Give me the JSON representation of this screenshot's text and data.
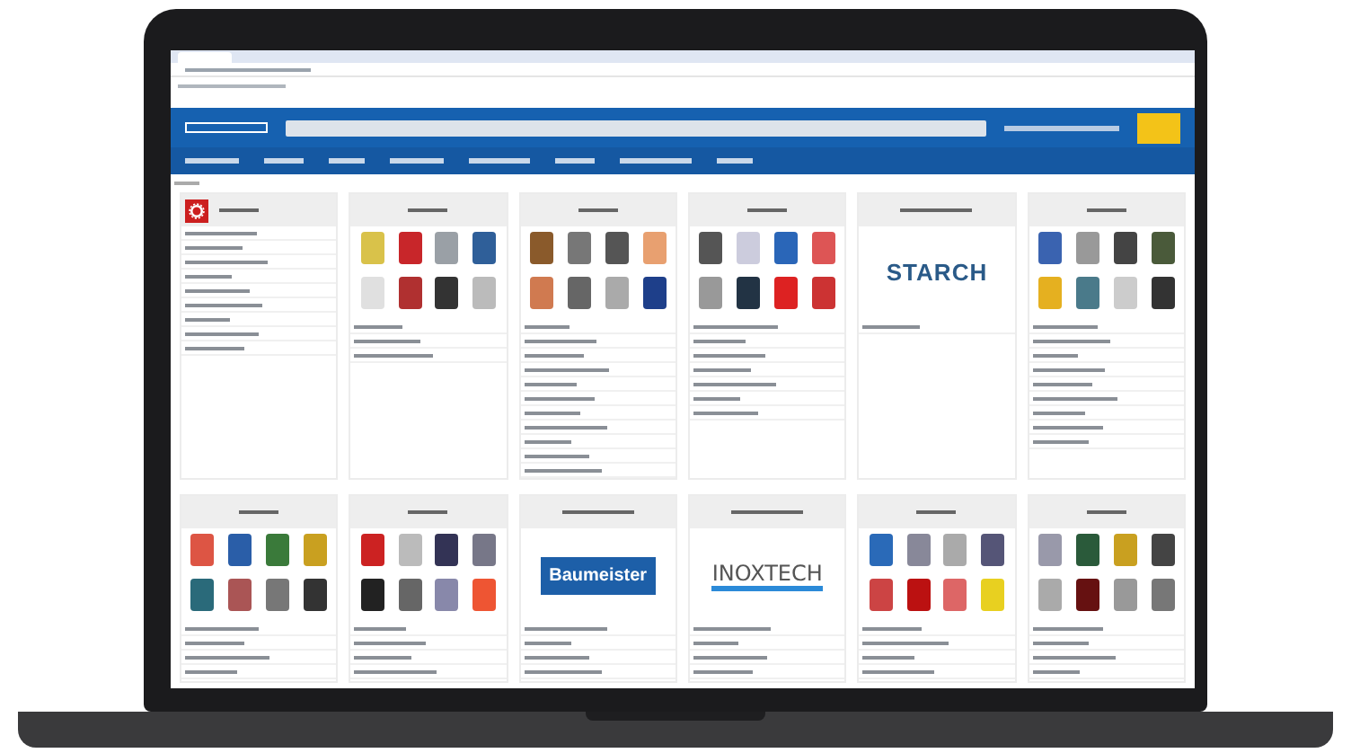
{
  "screen": {
    "cards": [
      {
        "kind": "icon-list"
      },
      {
        "kind": "photos"
      },
      {
        "kind": "photos"
      },
      {
        "kind": "photos"
      },
      {
        "kind": "logo-plain",
        "logo": "STARCH"
      },
      {
        "kind": "photos"
      },
      {
        "kind": "photos"
      },
      {
        "kind": "photos"
      },
      {
        "kind": "logo-banner",
        "logo": "Baumeister"
      },
      {
        "kind": "logo-stripe",
        "logo": "INOXTECH"
      },
      {
        "kind": "photos"
      },
      {
        "kind": "photos"
      }
    ]
  }
}
